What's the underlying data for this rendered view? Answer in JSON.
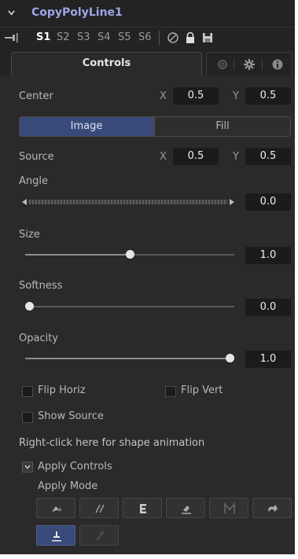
{
  "tool": {
    "name": "CopyPolyLine1"
  },
  "versions": {
    "tabs": [
      "S1",
      "S2",
      "S3",
      "S4",
      "S5",
      "S6"
    ],
    "active": "S1"
  },
  "tabs": {
    "controls_label": "Controls"
  },
  "center": {
    "label": "Center",
    "x_axis": "X",
    "x_value": "0.5",
    "y_axis": "Y",
    "y_value": "0.5"
  },
  "segment": {
    "image_label": "Image",
    "fill_label": "Fill",
    "selected": "Image"
  },
  "source": {
    "label": "Source",
    "x_axis": "X",
    "x_value": "0.5",
    "y_axis": "Y",
    "y_value": "0.5"
  },
  "angle": {
    "label": "Angle",
    "value": "0.0"
  },
  "size": {
    "label": "Size",
    "value": "1.0",
    "slider_fraction": 0.5
  },
  "softness": {
    "label": "Softness",
    "value": "0.0",
    "slider_fraction": 0.0
  },
  "opacity": {
    "label": "Opacity",
    "value": "1.0",
    "slider_fraction": 1.0
  },
  "checks": {
    "flip_horiz": "Flip Horiz",
    "flip_vert": "Flip Vert",
    "show_source": "Show Source"
  },
  "note": "Right-click here for shape animation",
  "apply_controls": {
    "label": "Apply Controls",
    "mode_label": "Apply Mode"
  },
  "colors": {
    "accent": "#384a7a",
    "title": "#9aa6e8",
    "panel": "#2a2a2a"
  }
}
